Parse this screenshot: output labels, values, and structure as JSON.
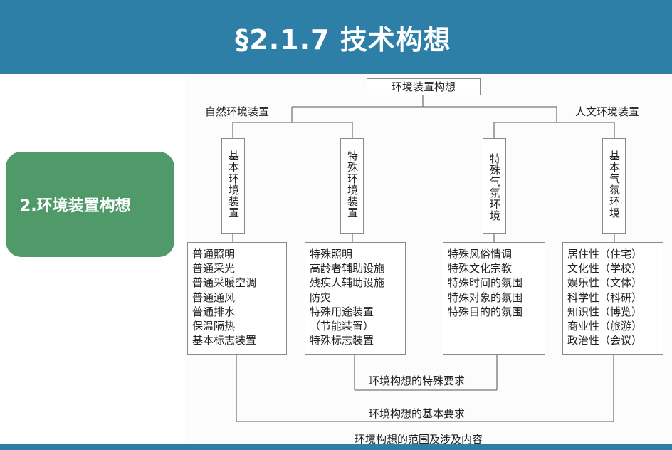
{
  "header": {
    "title": "§2.1.7 技术构想"
  },
  "sidebar": {
    "label": "2.环境装置构想"
  },
  "diagram": {
    "root": "环境装置构想",
    "left_branch": "自然环境装置",
    "right_branch": "人文环境装置",
    "columns": [
      {
        "heading": "基本环境装置",
        "items": [
          "普通照明",
          "普通采光",
          "普通采暖空调",
          "普通通风",
          "普通排水",
          "保温隔热",
          "基本标志装置"
        ]
      },
      {
        "heading": "特殊环境装置",
        "items": [
          "特殊照明",
          "高龄者辅助设施",
          "残疾人辅助设施",
          "防灾",
          "特殊用途装置",
          "（节能装置）",
          "特殊标志装置"
        ]
      },
      {
        "heading": "特殊气氛环境",
        "items": [
          "特殊风俗情调",
          "特殊文化宗教",
          "特殊时间的氛围",
          "特殊对象的氛围",
          "特殊目的的氛围"
        ]
      },
      {
        "heading": "基本气氛环境",
        "items": [
          "居住性（住宅）",
          "文化性（学校）",
          "娱乐性（文体）",
          "科学性（科研）",
          "知识性（博览）",
          "商业性（旅游）",
          "政治性（会议）"
        ]
      }
    ],
    "special_requirement": "环境构想的特殊要求",
    "basic_requirement": "环境构想的基本要求",
    "caption": "环境构想的范围及涉及内容"
  }
}
